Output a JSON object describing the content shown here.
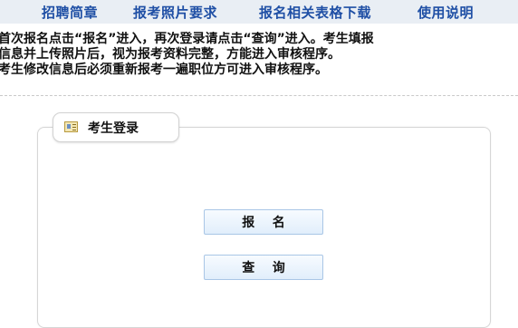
{
  "nav": {
    "items": [
      {
        "label": "招聘简章"
      },
      {
        "label": "报考照片要求"
      },
      {
        "label": "报名相关表格下载"
      },
      {
        "label": "使用说明"
      }
    ]
  },
  "notice": {
    "lines": [
      "首次报名点击“报名”进入，再次登录请点击“查询”进入。考生填报",
      "信息并上传照片后，视为报考资料完整，方能进入审核程序。",
      "考生修改信息后必须重新报考一遍职位方可进入审核程序。"
    ]
  },
  "login_panel": {
    "title": "考生登录",
    "icon": "id-card-icon",
    "apply_label": "报    名",
    "query_label": "查    询"
  },
  "colors": {
    "nav_text": "#1f4fa5",
    "nav_bg": "#e9eef4",
    "button_border": "#a9c6e6"
  }
}
